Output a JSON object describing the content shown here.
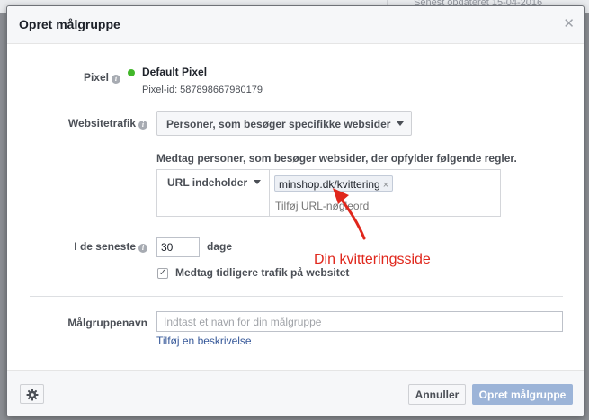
{
  "background": {
    "updated_text": "Senest opdateret 15-04-2016"
  },
  "dialog": {
    "title": "Opret målgruppe",
    "close_icon": "close-icon"
  },
  "pixel": {
    "label": "Pixel",
    "name": "Default Pixel",
    "id_text": "Pixel-id: 587898667980179",
    "status_color": "#42b72a"
  },
  "website_traffic": {
    "label": "Websitetrafik",
    "selected": "Personer, som besøger specifikke websider"
  },
  "rules": {
    "caption": "Medtag personer, som besøger websider, der opfylder følgende regler.",
    "condition": "URL indeholder",
    "token": "minshop.dk/kvittering",
    "input_placeholder": "Tilføj URL-nøgleord"
  },
  "period": {
    "label": "I de seneste",
    "value": "30",
    "unit": "dage"
  },
  "include_past": {
    "checked": true,
    "check_mark": "✓",
    "label": "Medtag tidligere trafik på websitet"
  },
  "audience_name": {
    "label": "Målgruppenavn",
    "placeholder": "Indtast et navn for din målgruppe",
    "add_description": "Tilføj en beskrivelse"
  },
  "footer": {
    "cancel_label": "Annuller",
    "create_label": "Opret målgruppe",
    "create_color": "#9cb4d8"
  },
  "annotation": {
    "text": "Din kvitteringsside",
    "color": "#e0271c"
  },
  "colors": {
    "link": "#365899",
    "accent_red": "#e0271c"
  }
}
